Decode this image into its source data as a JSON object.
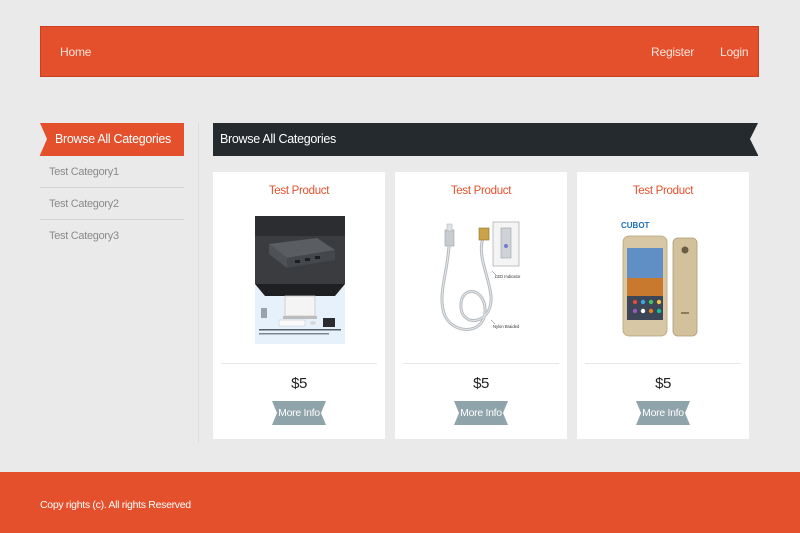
{
  "nav": {
    "home": "Home",
    "register": "Register",
    "login": "Login"
  },
  "sidebar": {
    "heading": "Browse All Categories",
    "items": [
      {
        "label": "Test Category1"
      },
      {
        "label": "Test Category2"
      },
      {
        "label": "Test Category3"
      }
    ]
  },
  "main": {
    "heading": "Browse All Categories",
    "products": [
      {
        "title": "Test Product",
        "price": "$5",
        "button": "More Info",
        "image": "usb-hub-product-photo"
      },
      {
        "title": "Test Product",
        "price": "$5",
        "button": "More Info",
        "image": "magnetic-cable-product-photo",
        "image_labels": [
          "LED Indicator",
          "Nylon Braided"
        ]
      },
      {
        "title": "Test Product",
        "price": "$5",
        "button": "More Info",
        "image": "smartphone-product-photo",
        "image_labels": [
          "CUBOT"
        ]
      }
    ]
  },
  "footer": {
    "text": "Copy rights (c). All rights Reserved"
  },
  "colors": {
    "brand": "#e4502c",
    "dark_heading": "#252a2e",
    "button": "#8fa3aa",
    "background": "#eaeaea"
  }
}
